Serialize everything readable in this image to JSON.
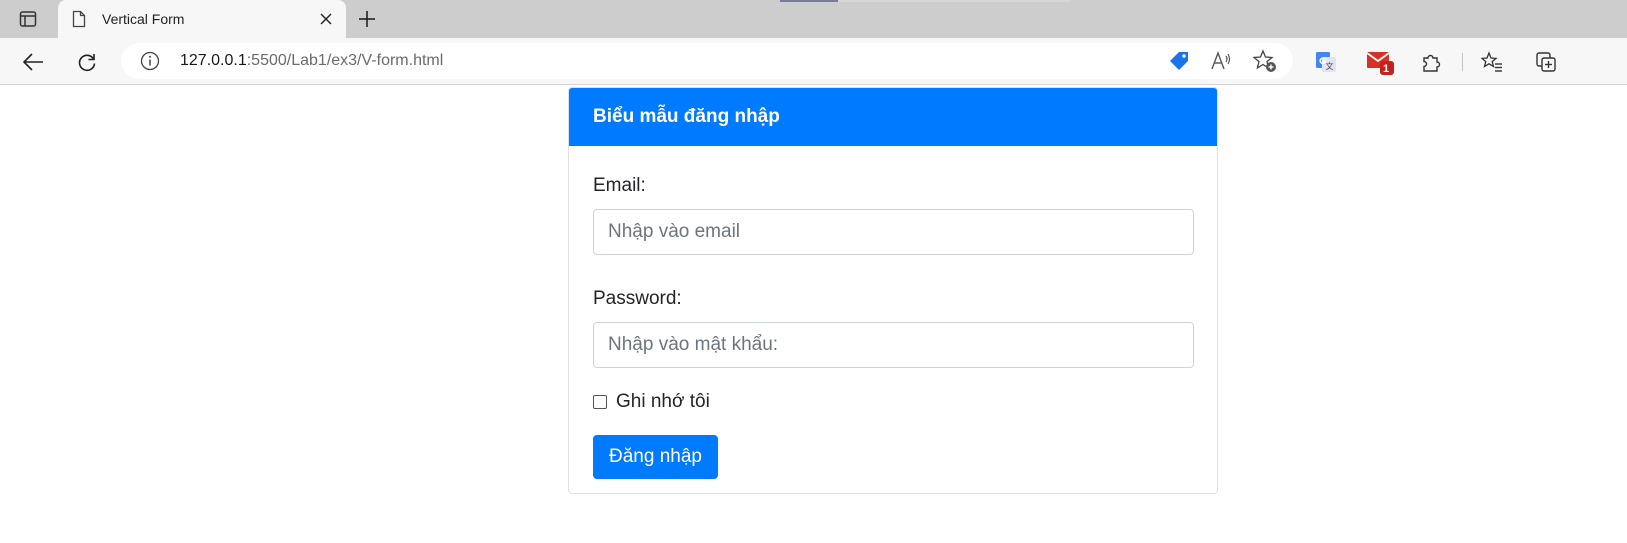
{
  "browser": {
    "tab": {
      "title": "Vertical Form"
    },
    "address": {
      "host": "127.0.0.1",
      "path": ":5500/Lab1/ex3/V-form.html"
    },
    "extensions": {
      "mail_badge": "1"
    }
  },
  "form": {
    "title": "Biểu mẫu đăng nhập",
    "email": {
      "label": "Email:",
      "placeholder": "Nhập vào email"
    },
    "password": {
      "label": "Password:",
      "placeholder": "Nhập vào mật khẩu:"
    },
    "remember": {
      "label": "Ghi nhớ tôi",
      "checked": false
    },
    "submit_label": "Đăng nhập"
  },
  "colors": {
    "primary": "#007bff",
    "chrome": "#cdcdcd",
    "toolbar": "#f7f7f7"
  },
  "icons": [
    "tab-actions-icon",
    "page-icon",
    "close-icon",
    "plus-icon",
    "back-icon",
    "refresh-icon",
    "info-icon",
    "coupon-tag-icon",
    "read-aloud-icon",
    "add-favorite-icon",
    "translate-icon",
    "mail-icon",
    "extensions-icon",
    "favorites-icon",
    "collections-icon"
  ]
}
